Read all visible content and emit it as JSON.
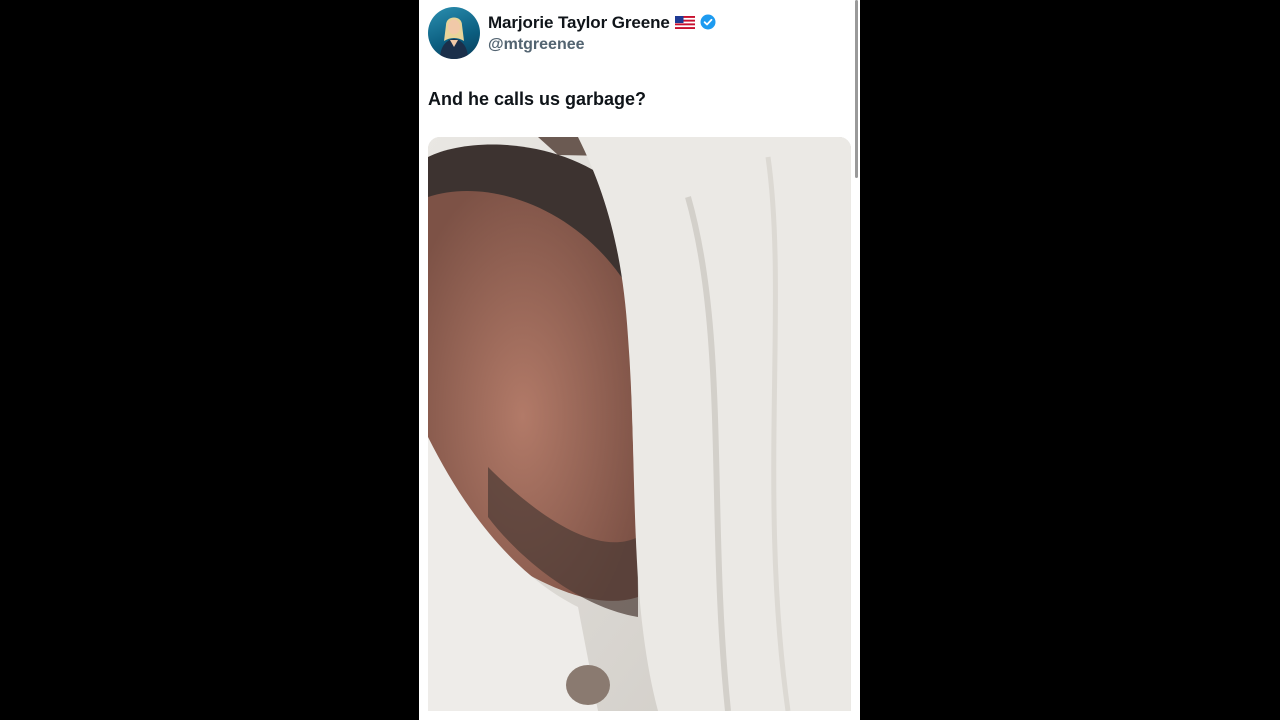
{
  "tweet": {
    "display_name": "Marjorie Taylor Greene",
    "flag_emoji": "🇺🇸",
    "handle": "@mtgreenee",
    "text": "And he calls us garbage?",
    "verified_icon": "verified-badge-icon",
    "accent_color": "#1d9bf0"
  }
}
